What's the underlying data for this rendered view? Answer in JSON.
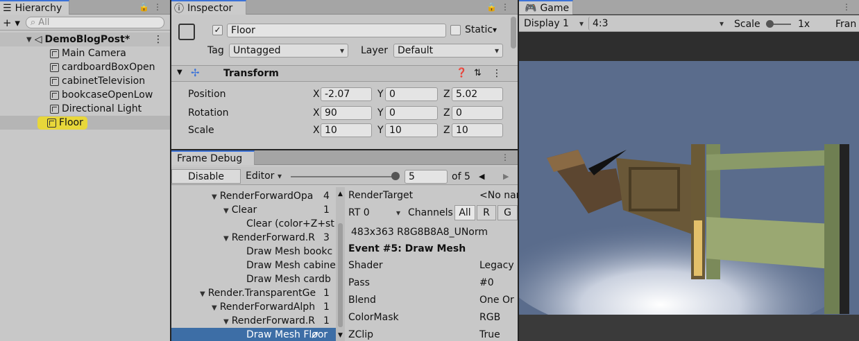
{
  "hierarchy": {
    "tab": "Hierarchy",
    "add": "+ ▾",
    "search_placeholder": "All",
    "scene": "DemoBlogPost*",
    "items": [
      "Main Camera",
      "cardboardBoxOpen",
      "cabinetTelevision",
      "bookcaseOpenLow",
      "Directional Light",
      "Floor"
    ]
  },
  "inspector": {
    "tab": "Inspector",
    "name": "Floor",
    "static": "Static",
    "tag_label": "Tag",
    "tag": "Untagged",
    "layer_label": "Layer",
    "layer": "Default",
    "transform": {
      "title": "Transform",
      "rows": [
        {
          "label": "Position",
          "x": "-2.07",
          "y": "0",
          "z": "5.02"
        },
        {
          "label": "Rotation",
          "x": "90",
          "y": "0",
          "z": "0"
        },
        {
          "label": "Scale",
          "x": "10",
          "y": "10",
          "z": "10"
        }
      ]
    },
    "axis": {
      "x": "X",
      "y": "Y",
      "z": "Z"
    }
  },
  "frame_debug": {
    "tab": "Frame Debug",
    "disable": "Disable",
    "editor": "Editor",
    "event_value": "5",
    "of": "of 5",
    "tree": [
      {
        "label": "RenderForwardOpa",
        "count": "4"
      },
      {
        "label": "Clear",
        "count": "1"
      },
      {
        "label": "Clear (color+Z+st",
        "count": ""
      },
      {
        "label": "RenderForward.R",
        "count": "3"
      },
      {
        "label": "Draw Mesh bookc",
        "count": ""
      },
      {
        "label": "Draw Mesh cabine",
        "count": ""
      },
      {
        "label": "Draw Mesh cardb",
        "count": ""
      },
      {
        "label": "Render.TransparentGe",
        "count": "1"
      },
      {
        "label": "RenderForwardAlph",
        "count": "1"
      },
      {
        "label": "RenderForward.R",
        "count": "1"
      },
      {
        "label": "Draw Mesh Floor",
        "count": ""
      }
    ],
    "render_target_label": "RenderTarget",
    "render_target": "<No nam",
    "rt": "RT 0",
    "channels": "Channels",
    "ch_all": "All",
    "ch_r": "R",
    "ch_g": "G",
    "format": "483x363 R8G8B8A8_UNorm",
    "event": "Event #5: Draw Mesh",
    "props": [
      {
        "k": "Shader",
        "v": "Legacy"
      },
      {
        "k": "Pass",
        "v": "#0"
      },
      {
        "k": "Blend",
        "v": "One Or"
      },
      {
        "k": "ColorMask",
        "v": "RGB"
      },
      {
        "k": "ZClip",
        "v": "True"
      }
    ]
  },
  "game": {
    "tab": "Game",
    "display": "Display 1",
    "aspect": "4:3",
    "scale_label": "Scale",
    "scale": "1x",
    "fra": "Fran"
  },
  "colors": {
    "accent": "#3a72d8",
    "selected": "#3d6ea6",
    "highlight": "#e8d73a",
    "sky": "#5a6c8c"
  }
}
